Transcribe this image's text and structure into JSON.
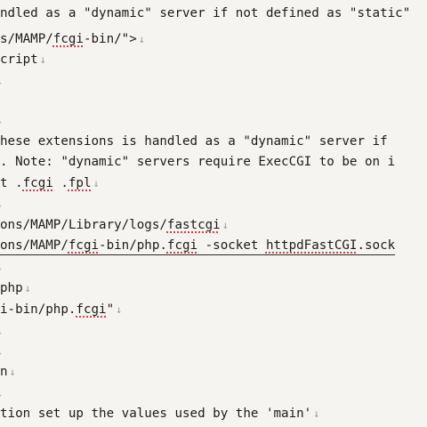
{
  "editor": {
    "lines": [
      {
        "text": "ndled as a \"dynamic\" server if not defined as \"static\"",
        "newline": false
      },
      {
        "pre": "s/MAMP/",
        "spell": "fcgi",
        "post": "-bin/\">",
        "newline": true
      },
      {
        "text": "cript",
        "newline": true
      },
      {
        "text": "",
        "newline": true
      },
      {
        "text": "",
        "newline": true
      },
      {
        "text": "hese extensions is handled as a \"dynamic\" server if",
        "newline": false
      },
      {
        "text": ". Note: \"dynamic\" servers require ExecCGI to be on i",
        "newline": false
      },
      {
        "pre": "t .",
        "spell": "fcgi",
        "mid": " .",
        "spell2": "fpl",
        "post": "",
        "newline": true
      },
      {
        "text": "",
        "newline": true
      },
      {
        "pre": "ons/MAMP/Library/logs/",
        "spell": "fastcgi",
        "post": "",
        "newline": true
      },
      {
        "pre": "ons/MAMP/",
        "spell": "fcgi",
        "mid": "-bin/php.",
        "spell2": "fcgi",
        "mid2": " -socket ",
        "spell3": "httpdFastCGI",
        "post": ".sock",
        "newline": false
      },
      {
        "text": "",
        "newline": true
      },
      {
        "text": "php",
        "newline": true
      },
      {
        "pre": "i-bin/php.",
        "spell": "fcgi",
        "post": "\"",
        "newline": true
      },
      {
        "text": "",
        "newline": true
      },
      {
        "text": "",
        "newline": true
      },
      {
        "text": "n",
        "newline": true
      },
      {
        "text": "",
        "newline": true
      },
      {
        "text": "tion set up the values used by the 'main'",
        "newline": true
      },
      {
        "text": "",
        "newline": true
      }
    ],
    "newline_glyph": "↓",
    "spell_color": "#d04545",
    "text_color": "#1b1b1b",
    "background_color": "#f5f4f0"
  }
}
